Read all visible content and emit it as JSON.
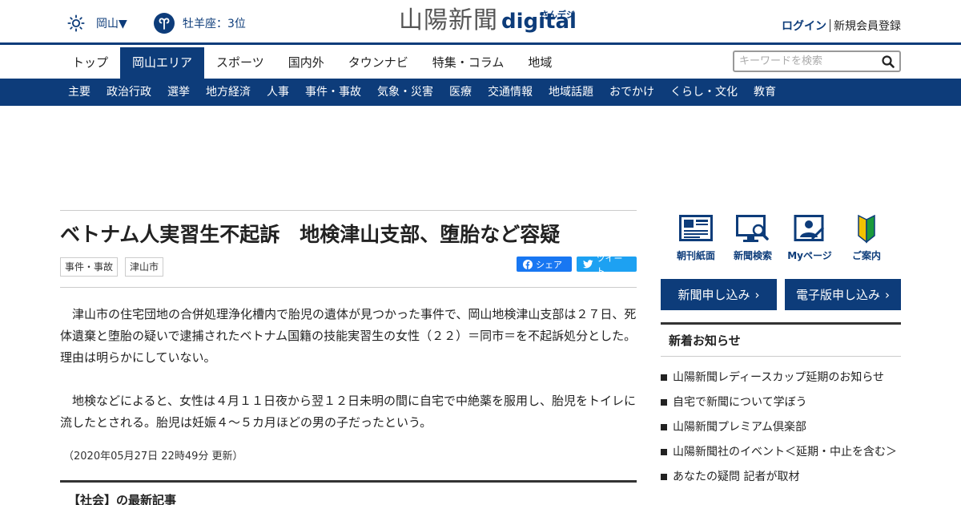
{
  "header": {
    "weather_region": "岡山▼",
    "horoscope": "牡羊座：3位",
    "logo_kanji": "山陽新聞",
    "logo_digital": "digital",
    "logo_kana": "さんデジ",
    "login": "ログイン",
    "register": "新規会員登録"
  },
  "main_nav": [
    "トップ",
    "岡山エリア",
    "スポーツ",
    "国内外",
    "タウンナビ",
    "特集・コラム",
    "地域"
  ],
  "main_nav_active": "岡山エリア",
  "search": {
    "placeholder": "キーワードを検索"
  },
  "sub_nav": [
    "主要",
    "政治行政",
    "選挙",
    "地方経済",
    "人事",
    "事件・事故",
    "気象・災害",
    "医療",
    "交通情報",
    "地域話題",
    "おでかけ",
    "くらし・文化",
    "教育"
  ],
  "article": {
    "headline": "ベトナム人実習生不起訴　地検津山支部、堕胎など容疑",
    "tags": [
      "事件・事故",
      "津山市"
    ],
    "share_fb": "シェア",
    "share_tw": "ツイート",
    "paragraphs": [
      "津山市の住宅団地の合併処理浄化槽内で胎児の遺体が見つかった事件で、岡山地検津山支部は２７日、死体遺棄と堕胎の疑いで逮捕されたベトナム国籍の技能実習生の女性（２２）＝同市＝を不起訴処分とした。理由は明らかにしていない。",
      "地検などによると、女性は４月１１日夜から翌１２日未明の間に自宅で中絶薬を服用し、胎児をトイレに流したとされる。胎児は妊娠４～５カ月ほどの男の子だったという。"
    ],
    "updated": "（2020年05月27日 22時49分 更新）",
    "latest_heading": "【社会】の最新記事"
  },
  "sidebar": {
    "icons": [
      {
        "label": "朝刊紙面",
        "icon": "newspaper-icon"
      },
      {
        "label": "新聞検索",
        "icon": "search-monitor-icon"
      },
      {
        "label": "Myページ",
        "icon": "mypage-icon"
      },
      {
        "label": "ご案内",
        "icon": "beginner-mark-icon"
      }
    ],
    "cta": [
      "新聞申し込み",
      "電子版申し込み"
    ],
    "news_title": "新着お知らせ",
    "news": [
      "山陽新聞レディースカップ延期のお知らせ",
      "自宅で新聞について学ぼう",
      "山陽新聞プレミアム倶楽部",
      "山陽新聞社のイベント＜延期・中止を含む＞",
      "あなたの疑問 記者が取材"
    ]
  },
  "colors": {
    "brand": "#0d3c7a",
    "facebook": "#1877f2",
    "twitter": "#1da1f2"
  }
}
